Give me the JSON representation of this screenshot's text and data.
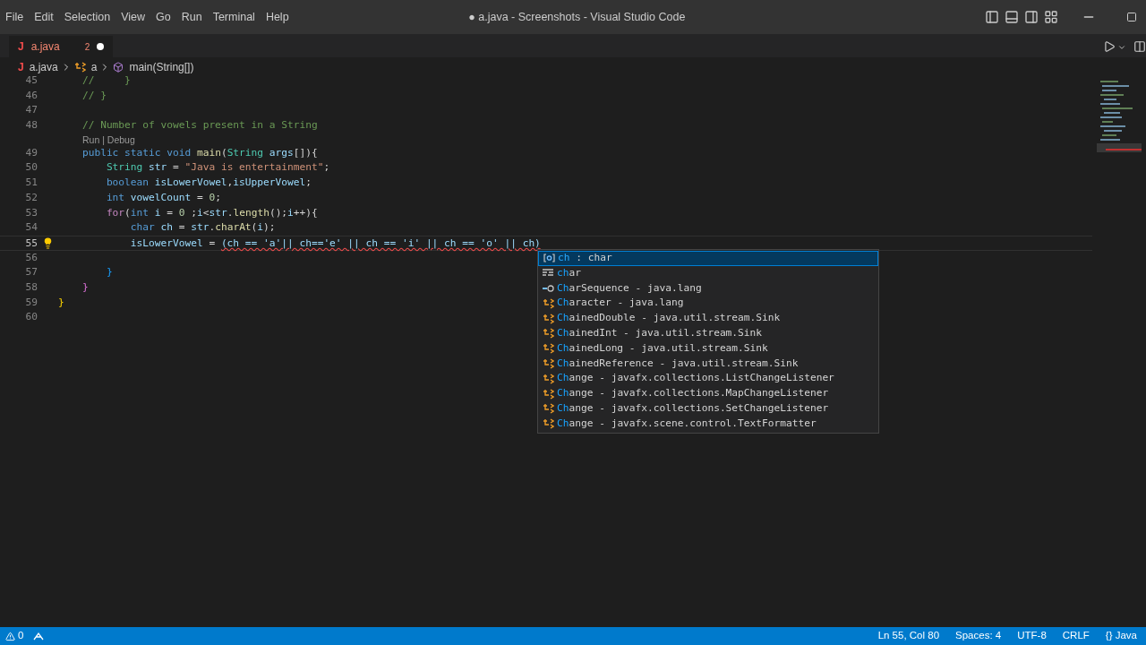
{
  "menu": [
    "File",
    "Edit",
    "Selection",
    "View",
    "Go",
    "Run",
    "Terminal",
    "Help"
  ],
  "window": {
    "title": "● a.java - Screenshots - Visual Studio Code"
  },
  "tab": {
    "icon": "J",
    "label": "a.java",
    "problems": "2",
    "modified": true,
    "selected": true
  },
  "breadcrumbs": [
    {
      "kind": "file",
      "icon": "J",
      "label": "a.java"
    },
    {
      "kind": "class",
      "label": "a"
    },
    {
      "kind": "method",
      "label": "main(String[])"
    }
  ],
  "code_lines": [
    {
      "number": "45",
      "tokens": [
        {
          "kind": "comment",
          "text": "    //     }"
        }
      ]
    },
    {
      "number": "46",
      "tokens": [
        {
          "kind": "comment",
          "text": "    // }"
        }
      ]
    },
    {
      "number": "47"
    },
    {
      "number": "48",
      "tokens": [
        {
          "kind": "comment",
          "text": "    // Number of vowels present in a String"
        }
      ]
    },
    {
      "number": "49",
      "codelens": "Run | Debug",
      "tokens": [
        {
          "kind": "keyword",
          "text": "    public static void "
        },
        {
          "kind": "func",
          "text": "main"
        },
        {
          "kind": "plain",
          "text": "("
        },
        {
          "kind": "type",
          "text": "String "
        },
        {
          "kind": "var",
          "text": "args"
        },
        {
          "kind": "plain",
          "text": "[]){"
        }
      ]
    },
    {
      "number": "50",
      "tokens": [
        {
          "kind": "type",
          "text": "        String "
        },
        {
          "kind": "var",
          "text": "str"
        },
        {
          "kind": "plain",
          "text": " = "
        },
        {
          "kind": "string",
          "text": "\"Java is entertainment\""
        },
        {
          "kind": "plain",
          "text": ";"
        }
      ]
    },
    {
      "number": "51",
      "tokens": [
        {
          "kind": "keyword",
          "text": "        boolean "
        },
        {
          "kind": "var",
          "text": "isLowerVowel"
        },
        {
          "kind": "plain",
          "text": ","
        },
        {
          "kind": "var",
          "text": "isUpperVowel"
        },
        {
          "kind": "plain",
          "text": ";"
        }
      ]
    },
    {
      "number": "52",
      "tokens": [
        {
          "kind": "keyword",
          "text": "        int "
        },
        {
          "kind": "var",
          "text": "vowelCount"
        },
        {
          "kind": "plain",
          "text": " = "
        },
        {
          "kind": "number",
          "text": "0"
        },
        {
          "kind": "plain",
          "text": ";"
        }
      ]
    },
    {
      "number": "53",
      "tokens": [
        {
          "kind": "control",
          "text": "        for"
        },
        {
          "kind": "plain",
          "text": "("
        },
        {
          "kind": "keyword",
          "text": "int "
        },
        {
          "kind": "var",
          "text": "i"
        },
        {
          "kind": "plain",
          "text": " = "
        },
        {
          "kind": "number",
          "text": "0"
        },
        {
          "kind": "plain",
          "text": " ;"
        },
        {
          "kind": "var",
          "text": "i"
        },
        {
          "kind": "plain",
          "text": "<"
        },
        {
          "kind": "var",
          "text": "str"
        },
        {
          "kind": "plain",
          "text": "."
        },
        {
          "kind": "func",
          "text": "length"
        },
        {
          "kind": "plain",
          "text": "();"
        },
        {
          "kind": "var",
          "text": "i"
        },
        {
          "kind": "plain",
          "text": "++){"
        }
      ]
    },
    {
      "number": "54",
      "tokens": [
        {
          "kind": "keyword",
          "text": "            char "
        },
        {
          "kind": "var",
          "text": "ch"
        },
        {
          "kind": "plain",
          "text": " = "
        },
        {
          "kind": "var",
          "text": "str"
        },
        {
          "kind": "plain",
          "text": "."
        },
        {
          "kind": "func",
          "text": "charAt"
        },
        {
          "kind": "plain",
          "text": "("
        },
        {
          "kind": "var",
          "text": "i"
        },
        {
          "kind": "plain",
          "text": ");"
        }
      ]
    },
    {
      "number": "55",
      "lightbulb": true,
      "current": true,
      "tokens": [
        {
          "kind": "var",
          "text": "            isLowerVowel"
        },
        {
          "kind": "plain",
          "text": " = "
        },
        {
          "kind": "error",
          "text": "(ch == 'a'|| ch=='e' || ch == 'i' || ch == 'o' || ch)"
        }
      ]
    },
    {
      "number": "56"
    },
    {
      "number": "57",
      "tokens": [
        {
          "kind": "bracket",
          "text": "        }"
        }
      ]
    },
    {
      "number": "58",
      "tokens": [
        {
          "kind": "bracket2",
          "text": "    }"
        }
      ]
    },
    {
      "number": "59",
      "tokens": [
        {
          "kind": "bracket3",
          "text": "}"
        }
      ]
    },
    {
      "number": "60"
    }
  ],
  "suggestions": [
    {
      "kind": "variable",
      "match": "ch",
      "detail": " : char",
      "selected": true
    },
    {
      "kind": "keyword",
      "match": "ch",
      "rest": "ar",
      "selected": false
    },
    {
      "kind": "interface",
      "match": "Ch",
      "rest": "arSequence",
      "detail": " - java.lang",
      "selected": false
    },
    {
      "kind": "class",
      "match": "Ch",
      "rest": "aracter",
      "detail": " - java.lang",
      "selected": false
    },
    {
      "kind": "class",
      "match": "Ch",
      "rest": "ainedDouble",
      "detail": " - java.util.stream.Sink",
      "selected": false
    },
    {
      "kind": "class",
      "match": "Ch",
      "rest": "ainedInt",
      "detail": " - java.util.stream.Sink",
      "selected": false
    },
    {
      "kind": "class",
      "match": "Ch",
      "rest": "ainedLong",
      "detail": " - java.util.stream.Sink",
      "selected": false
    },
    {
      "kind": "class",
      "match": "Ch",
      "rest": "ainedReference",
      "detail": " - java.util.stream.Sink",
      "selected": false
    },
    {
      "kind": "class",
      "match": "Ch",
      "rest": "ange",
      "detail": " - javafx.collections.ListChangeListener",
      "selected": false
    },
    {
      "kind": "class",
      "match": "Ch",
      "rest": "ange",
      "detail": " - javafx.collections.MapChangeListener",
      "selected": false
    },
    {
      "kind": "class",
      "match": "Ch",
      "rest": "ange",
      "detail": " - javafx.collections.SetChangeListener",
      "selected": false
    },
    {
      "kind": "class",
      "match": "Ch",
      "rest": "ange",
      "detail": " - javafx.scene.control.TextFormatter",
      "selected": false
    }
  ],
  "status_bar": {
    "problems": "0",
    "right": [
      "Ln 55, Col 80",
      "Spaces: 4",
      "UTF-8",
      "CRLF",
      "{} Java"
    ]
  }
}
